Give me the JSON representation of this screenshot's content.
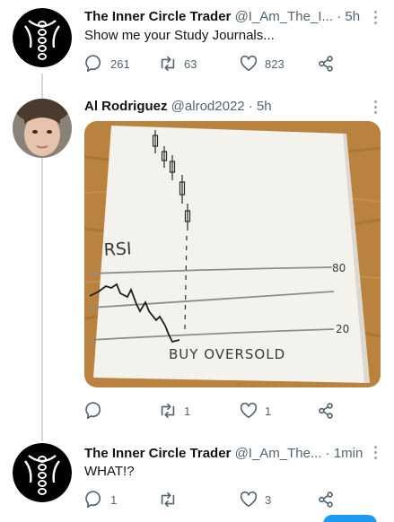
{
  "tweets": [
    {
      "display_name": "The Inner Circle Trader",
      "handle": "@I_Am_The_I...",
      "separator": "·",
      "time": "5h",
      "text": "Show me your Study Journals...",
      "actions": {
        "replies": "261",
        "retweets": "63",
        "likes": "823"
      }
    },
    {
      "display_name": "Al Rodriguez",
      "handle": "@alrod2022",
      "separator": "·",
      "time": "5h",
      "image": {
        "handwritten_labels": [
          "RSI",
          "80",
          "20",
          "BUY OVERSOLD"
        ]
      },
      "actions": {
        "replies": "",
        "retweets": "1",
        "likes": "1"
      }
    },
    {
      "display_name": "The Inner Circle Trader",
      "handle": "@I_Am_The...",
      "separator": "·",
      "time": "1min",
      "text": "WHAT!?",
      "actions": {
        "replies": "1",
        "retweets": "",
        "likes": "3"
      }
    }
  ],
  "colors": {
    "text_primary": "#0f1419",
    "text_secondary": "#536471",
    "icon": "#536471",
    "thread_line": "#cfd9de",
    "accent_blue": "#1d9bf0",
    "table_wood": "#b9823f"
  },
  "icons": [
    "reply-icon",
    "retweet-icon",
    "like-icon",
    "share-icon",
    "more-icon"
  ]
}
